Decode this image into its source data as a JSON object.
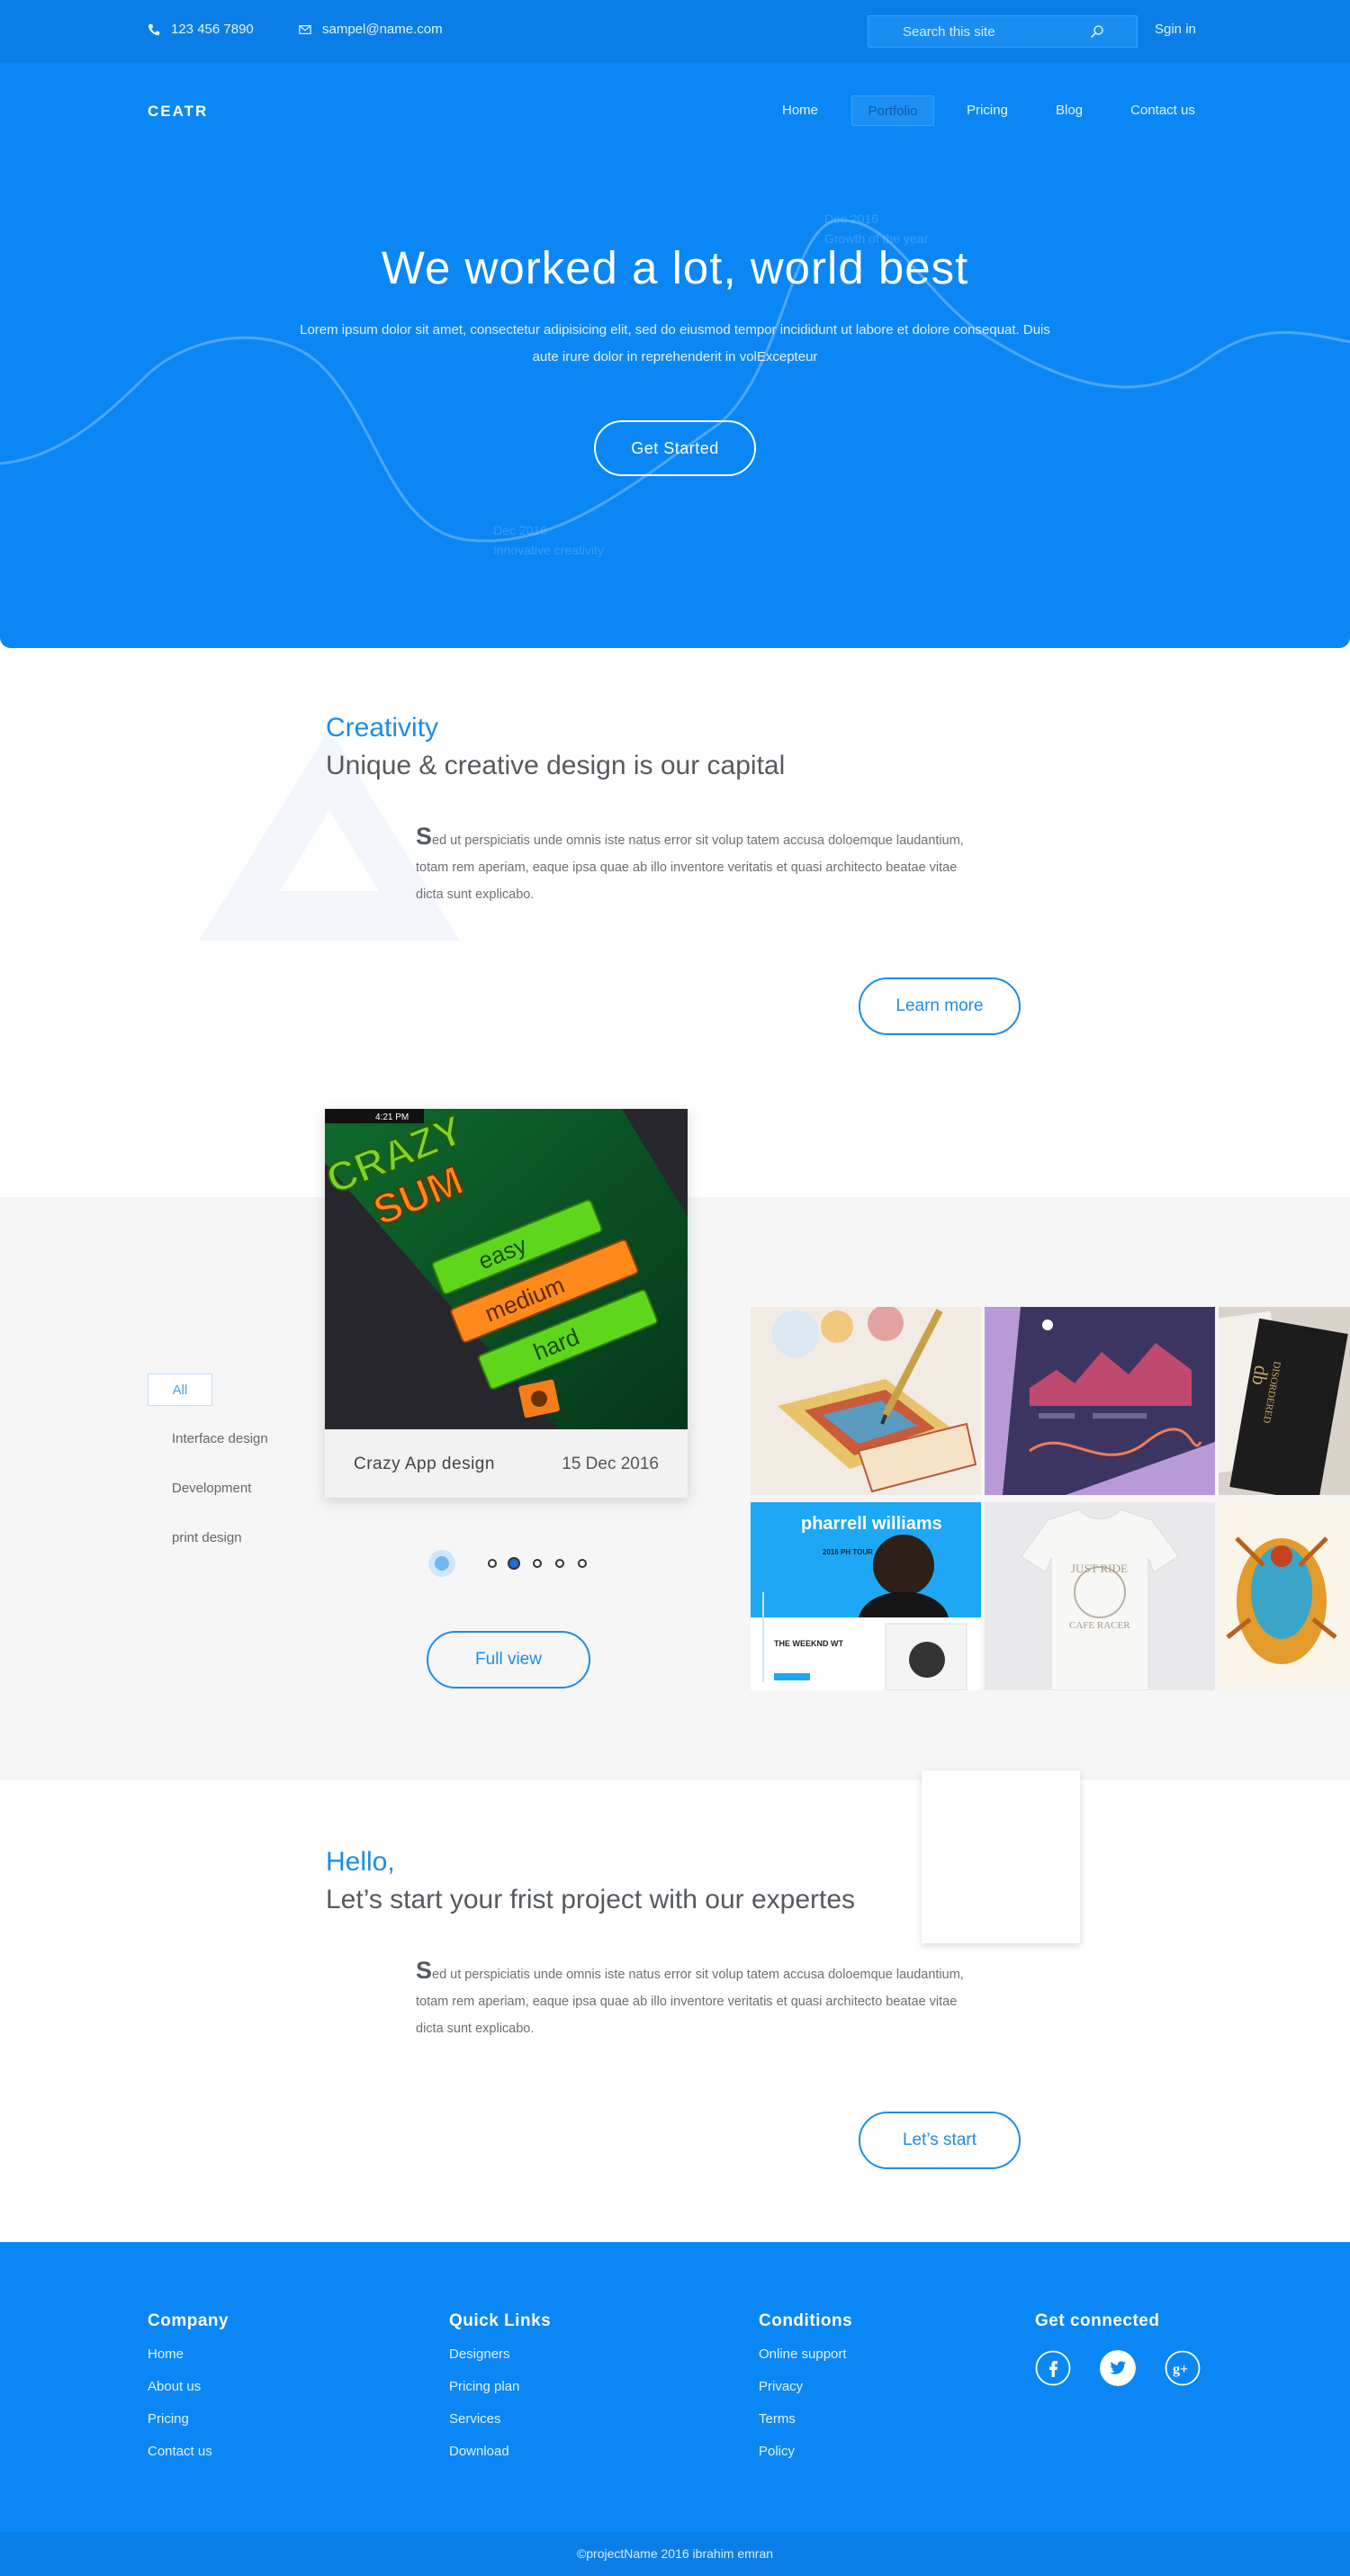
{
  "topbar": {
    "phone": "123 456 7890",
    "email": "sampel@name.com",
    "search_placeholder": "Search this site",
    "signin": "Sgin in"
  },
  "header": {
    "logo": "CEATR",
    "nav": [
      "Home",
      "Portfolio",
      "Pricing",
      "Blog",
      "Contact us"
    ],
    "active_nav": "Portfolio"
  },
  "hero": {
    "title": "We worked a lot, world best",
    "subtitle": "Lorem ipsum dolor sit amet, consectetur adipisicing elit, sed do eiusmod tempor incididunt ut labore et dolore consequat. Duis aute irure dolor in reprehenderit in volExcepteur",
    "cta": "Get Started",
    "ghost_label_1": {
      "date": "Dec 2016",
      "text": "Growth of the year"
    },
    "ghost_label_2": {
      "date": "Dec 2016",
      "text": "Innovative creativity"
    }
  },
  "creativity": {
    "kicker": "Creativity",
    "title": "Unique & creative design is our capital",
    "dropcap": "S",
    "body": "ed ut perspiciatis unde omnis iste natus error sit volup tatem accusa doloemque laudantium, totam rem aperiam, eaque ipsa quae ab illo inventore veritatis et quasi architecto beatae vitae dicta sunt explicabo.",
    "button": "Learn more"
  },
  "portfolio": {
    "filters": [
      "All",
      "Interface design",
      "Development",
      "print design"
    ],
    "active_filter": "All",
    "card": {
      "name": "Crazy App design",
      "date": "15 Dec 2016",
      "image_words": [
        "CRAZY",
        "SUM",
        "easy",
        "medium",
        "hard"
      ],
      "status_time": "4:21 PM"
    },
    "button": "Full view",
    "tiles": {
      "poster_title": "pharrell williams",
      "poster_tour": "2016 PH TOUR",
      "poster_sub": "THE WEEKND WT",
      "shirt_text": "JUST RIDE",
      "shirt_sub": "CAFE RACER",
      "card_brand": "DISORDERED",
      "card_mark": "db"
    }
  },
  "project": {
    "kicker": "Hello,",
    "title": "Let’s start your frist project with our expertes",
    "dropcap": "S",
    "body": "ed ut perspiciatis unde omnis iste natus error sit volup tatem accusa doloemque laudantium, totam rem aperiam, eaque ipsa quae ab illo inventore veritatis et quasi architecto beatae vitae dicta sunt explicabo.",
    "button": "Let’s start"
  },
  "footer": {
    "company": {
      "title": "Company",
      "links": [
        "Home",
        "About us",
        "Pricing",
        "Contact us"
      ]
    },
    "quick": {
      "title": "Quick Links",
      "links": [
        "Designers",
        "Pricing plan",
        "Services",
        "Download"
      ]
    },
    "conditions": {
      "title": "Conditions",
      "links": [
        "Online support",
        "Privacy",
        "Terms",
        "Policy"
      ]
    },
    "social": {
      "title": "Get connected",
      "icons": [
        "facebook-icon",
        "twitter-icon",
        "google-plus-icon"
      ]
    },
    "copyright": "©projectName 2016 ibrahim emran"
  },
  "colors": {
    "primary": "#0a87f5",
    "topbar": "#0a7ee6",
    "accent": "#1b8de6",
    "section_gray": "#f6f6f6"
  }
}
